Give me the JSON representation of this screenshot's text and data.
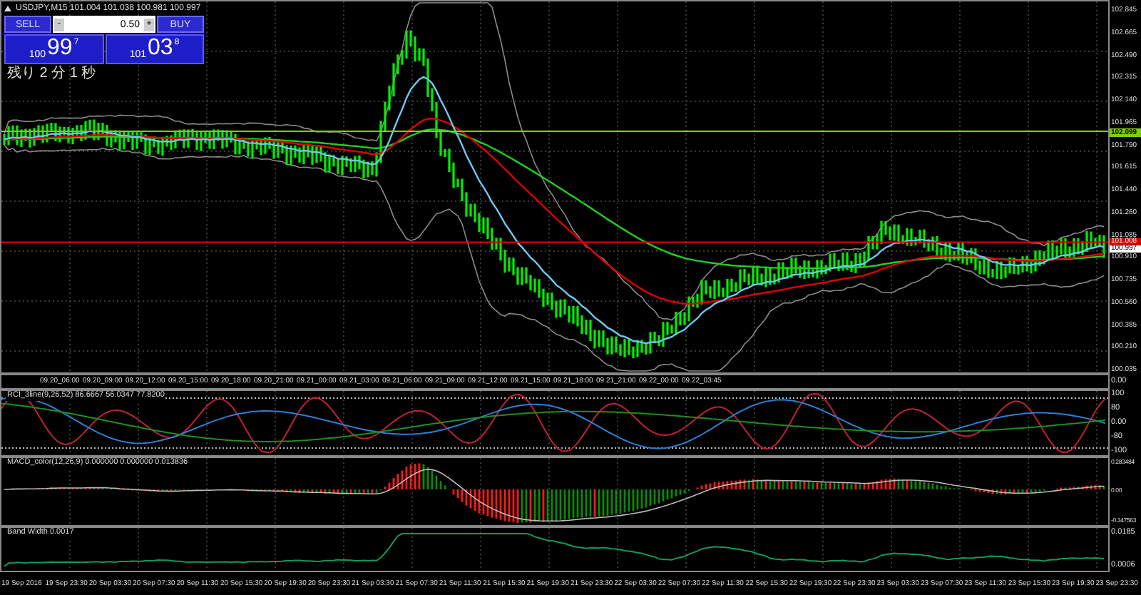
{
  "chart_header": {
    "text": "USDJPY,M15  101.004 101.038 100.981 100.997"
  },
  "trade_panel": {
    "sell_label": "SELL",
    "buy_label": "BUY",
    "lot": "0.50",
    "decrease": "-",
    "increase": "+",
    "sell_price": {
      "prefix": "100",
      "big": "99",
      "sup": "7"
    },
    "buy_price": {
      "prefix": "101",
      "big": "03",
      "sup": "8"
    }
  },
  "countdown": "残り 2 分 1 秒",
  "price_axis": [
    "102.845",
    "102.665",
    "102.490",
    "102.315",
    "102.140",
    "101.965",
    "101.790",
    "101.615",
    "101.440",
    "101.260",
    "101.085",
    "100.910",
    "100.735",
    "100.560",
    "100.385",
    "100.210",
    "100.035"
  ],
  "price_markers": [
    {
      "label": "102.099",
      "color": "#7fd000"
    },
    {
      "label": "101.008",
      "color": "#e00000"
    },
    {
      "label": "100.997",
      "color": "#ffffff"
    }
  ],
  "time_pane": {
    "labels": [
      "09.20_06:00",
      "09.20_09:00",
      "09.20_12:00",
      "09.20_15:00",
      "09.20_18:00",
      "09.20_21:00",
      "09.21_00:00",
      "09.21_03:00",
      "09.21_06:00",
      "09.21_09:00",
      "09.21_12:00",
      "09.21_15:00",
      "09.21_18:00",
      "09.21_21:00",
      "09.22_00:00",
      "09.22_03:45"
    ],
    "axis": [
      "0.00"
    ]
  },
  "rci": {
    "title": "RCI_3line(9,26,52) 86.6667 56.0347 77.8200",
    "axis": [
      "100",
      "80",
      "0.00",
      "-80",
      "-100"
    ]
  },
  "macd": {
    "title": "MACD_color(12,26,9) 0.000000 0.000000 0.013836",
    "axis": [
      "0.283484",
      "0.00",
      "-0.347563"
    ]
  },
  "band_width": {
    "title": "Band Width 0.0017",
    "axis": [
      "0.0185",
      "0.0006"
    ]
  },
  "time_axis": [
    "19 Sep 2016",
    "19 Sep 23:30",
    "20 Sep 03:30",
    "20 Sep 07:30",
    "20 Sep 11:30",
    "20 Sep 15:30",
    "20 Sep 19:30",
    "20 Sep 23:30",
    "21 Sep 03:30",
    "21 Sep 07:30",
    "21 Sep 11:30",
    "21 Sep 15:30",
    "21 Sep 19:30",
    "21 Sep 23:30",
    "22 Sep 03:30",
    "22 Sep 07:30",
    "22 Sep 11:30",
    "22 Sep 15:30",
    "22 Sep 19:30",
    "22 Sep 23:30",
    "23 Sep 03:30",
    "23 Sep 07:30",
    "23 Sep 11:30",
    "23 Sep 15:30",
    "23 Sep 19:30",
    "23 Sep 23:30"
  ]
}
